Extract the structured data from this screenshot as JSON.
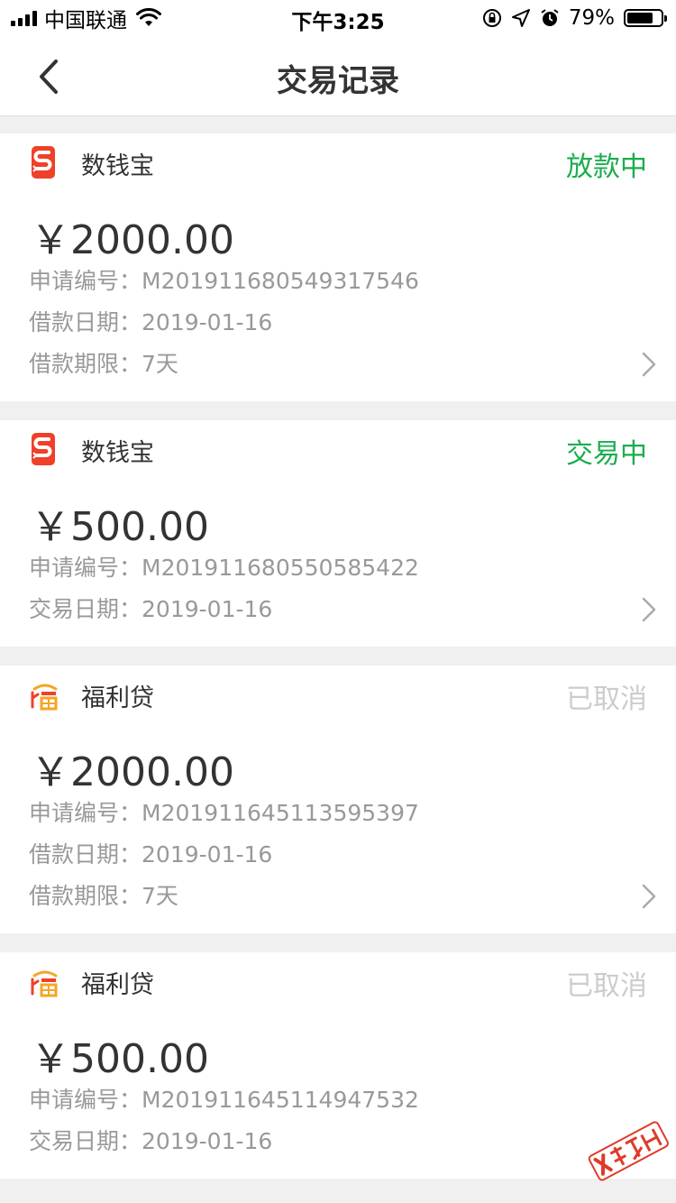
{
  "status_bar": {
    "carrier": "中国联通",
    "time": "下午3:25",
    "battery_percent": "79%",
    "battery_level": 0.79
  },
  "nav": {
    "title": "交易记录"
  },
  "colors": {
    "green": "#1aad4d",
    "muted": "#cccccc",
    "label": "#999999"
  },
  "records": [
    {
      "merchant": "数钱宝",
      "logo": "shuqianbao-logo",
      "status": "放款中",
      "status_color": "#1aad4d",
      "amount": "￥2000.00",
      "rows": [
        {
          "label": "申请编号：",
          "value": "M201911680549317546"
        },
        {
          "label": "借款日期：",
          "value": "2019-01-16"
        },
        {
          "label": "借款期限：",
          "value": "7天"
        }
      ]
    },
    {
      "merchant": "数钱宝",
      "logo": "shuqianbao-logo",
      "status": "交易中",
      "status_color": "#1aad4d",
      "amount": "￥500.00",
      "rows": [
        {
          "label": "申请编号：",
          "value": "M201911680550585422"
        },
        {
          "label": "交易日期：",
          "value": "2019-01-16"
        }
      ]
    },
    {
      "merchant": "福利贷",
      "logo": "fulidai-logo",
      "status": "已取消",
      "status_color": "#cccccc",
      "amount": "￥2000.00",
      "rows": [
        {
          "label": "申请编号：",
          "value": "M201911645113595397"
        },
        {
          "label": "借款日期：",
          "value": "2019-01-16"
        },
        {
          "label": "借款期限：",
          "value": "7天"
        }
      ]
    },
    {
      "merchant": "福利贷",
      "logo": "fulidai-logo",
      "status": "已取消",
      "status_color": "#cccccc",
      "amount": "￥500.00",
      "rows": [
        {
          "label": "申请编号：",
          "value": "M201911645114947532"
        },
        {
          "label": "交易日期：",
          "value": "2019-01-16"
        }
      ]
    }
  ],
  "watermark": {
    "text": "卡农社区"
  }
}
